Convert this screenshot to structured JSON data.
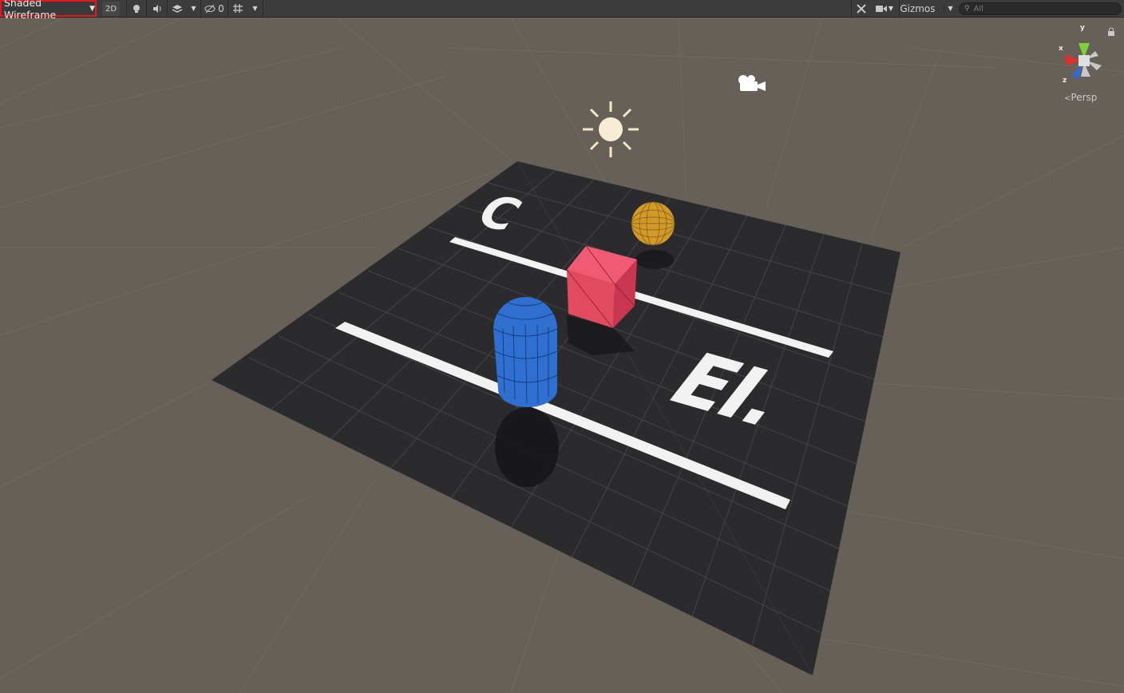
{
  "toolbar": {
    "draw_mode": "Shaded Wireframe",
    "btn_2d": "2D",
    "hidden_count": "0",
    "gizmos": "Gizmos",
    "search_placeholder": "All"
  },
  "scene": {
    "projection_label": "Persp",
    "axis_x": "x",
    "axis_y": "y",
    "axis_z": "z",
    "floor_text_left": "C",
    "floor_text_right": "EI."
  },
  "colors": {
    "highlight": "#e8171b",
    "cube": "#e24a60",
    "capsule": "#2f6fd0",
    "sphere": "#d39a2a",
    "plane": "#2b2b2d"
  },
  "icons": [
    "lightbulb-icon",
    "audio-icon",
    "effects-icon",
    "hidden-icon",
    "grid-icon",
    "tools-icon",
    "camera-icon",
    "search-icon",
    "lock-icon",
    "sun-light-icon",
    "scene-camera-icon"
  ]
}
